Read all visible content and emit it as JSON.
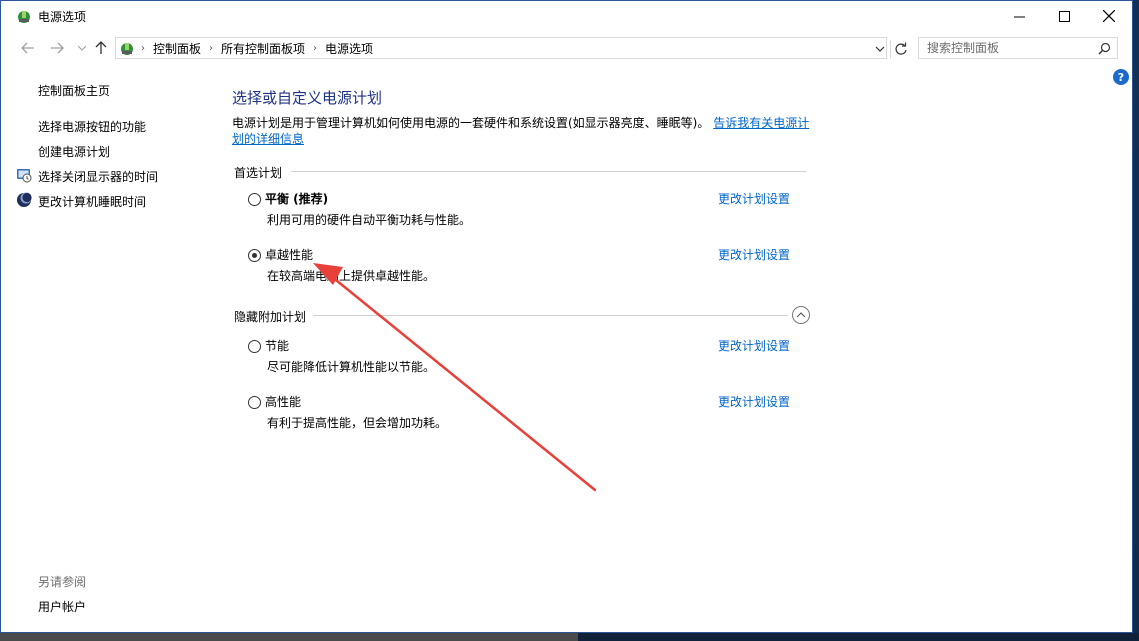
{
  "window": {
    "title": "电源选项"
  },
  "address": {
    "crumbs": [
      "控制面板",
      "所有控制面板项",
      "电源选项"
    ]
  },
  "search": {
    "placeholder": "搜索控制面板"
  },
  "help": {
    "label": "?"
  },
  "sidebar": {
    "home": "控制面板主页",
    "links": [
      "选择电源按钮的功能",
      "创建电源计划",
      "选择关闭显示器的时间",
      "更改计算机睡眠时间"
    ],
    "see_also": "另请参阅",
    "see_also_links": [
      "用户帐户"
    ]
  },
  "main": {
    "title": "选择或自定义电源计划",
    "description": "电源计划是用于管理计算机如何使用电源的一套硬件和系统设置(如显示器亮度、睡眠等)。",
    "description_link_1": "告诉我有关电源计",
    "description_link_2": "划的详细信息"
  },
  "preferred": {
    "label": "首选计划",
    "plans": [
      {
        "name": "平衡 (推荐)",
        "desc": "利用可用的硬件自动平衡功耗与性能。",
        "link": "更改计划设置",
        "selected": false
      },
      {
        "name": "卓越性能",
        "desc": "在较高端电脑上提供卓越性能。",
        "link": "更改计划设置",
        "selected": true
      }
    ]
  },
  "hidden": {
    "label": "隐藏附加计划",
    "plans": [
      {
        "name": "节能",
        "desc": "尽可能降低计算机性能以节能。",
        "link": "更改计划设置",
        "selected": false
      },
      {
        "name": "高性能",
        "desc": "有利于提高性能，但会增加功耗。",
        "link": "更改计划设置",
        "selected": false
      }
    ]
  },
  "colors": {
    "accent_link": "#0066cc",
    "title": "#1e3287",
    "annotation_arrow": "#e8413a"
  }
}
